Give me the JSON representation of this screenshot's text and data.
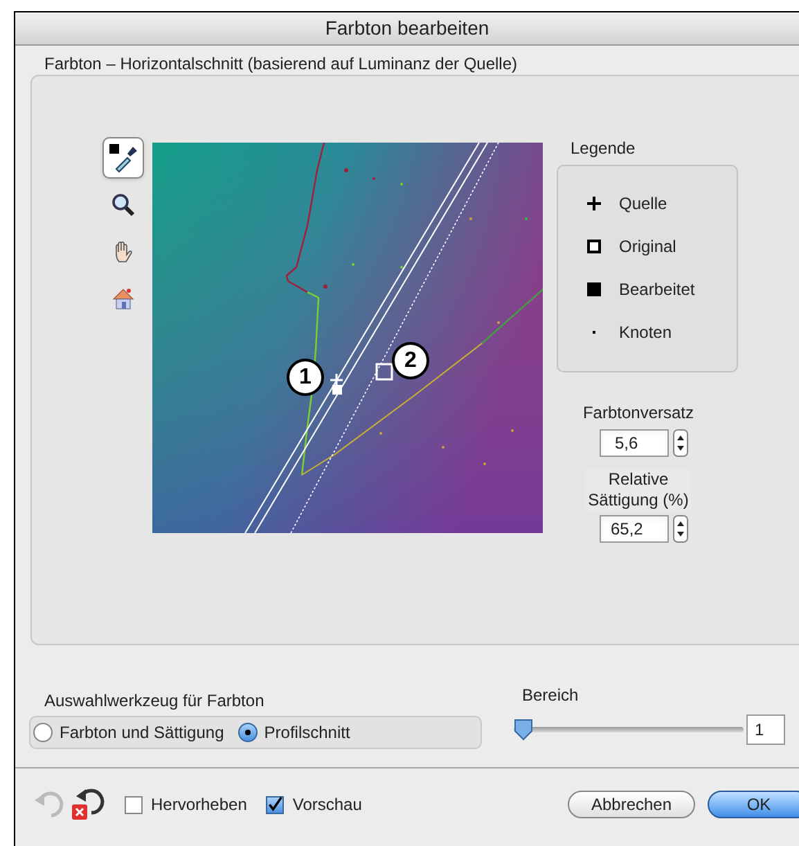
{
  "window": {
    "title": "Farbton bearbeiten"
  },
  "section": {
    "title": "Farbton – Horizontalschnitt (basierend auf Luminanz der Quelle)"
  },
  "tools": [
    {
      "kind": "eyedropper",
      "selected": true
    },
    {
      "kind": "zoom",
      "selected": false
    },
    {
      "kind": "hand",
      "selected": false
    },
    {
      "kind": "home",
      "selected": false
    }
  ],
  "plot": {
    "markers": [
      {
        "label": "1"
      },
      {
        "label": "2"
      }
    ]
  },
  "legend": {
    "title": "Legende",
    "items": [
      {
        "kind": "plus",
        "label": "Quelle"
      },
      {
        "kind": "open-square",
        "label": "Original"
      },
      {
        "kind": "filled-square",
        "label": "Bearbeitet"
      },
      {
        "kind": "dot",
        "label": "Knoten"
      }
    ]
  },
  "hue_offset": {
    "label": "Farbtonversatz",
    "value": "5,6"
  },
  "relative_saturation": {
    "label": "Relative Sättigung (%)",
    "value": "65,2"
  },
  "selection_tool": {
    "title": "Auswahlwerkzeug für Farbton",
    "options": [
      {
        "label": "Farbton und Sättigung",
        "selected": false
      },
      {
        "label": "Profilschnitt",
        "selected": true
      }
    ]
  },
  "range": {
    "label": "Bereich",
    "level": 0.0,
    "value": "1"
  },
  "footer": {
    "checkboxes": [
      {
        "label": "Hervorheben",
        "checked": false
      },
      {
        "label": "Vorschau",
        "checked": true
      }
    ],
    "buttons": [
      {
        "label": "Abbrechen",
        "kind": "normal"
      },
      {
        "label": "OK",
        "kind": "default"
      }
    ]
  }
}
